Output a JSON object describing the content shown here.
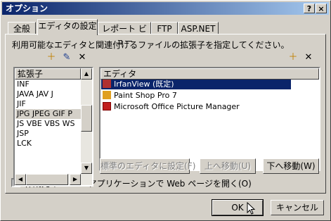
{
  "window": {
    "title": "オプション",
    "help_btn": "?",
    "close_btn": "×"
  },
  "tabs": [
    {
      "label": "全般"
    },
    {
      "label": "エディタの設定",
      "active": true
    },
    {
      "label": "レポート ビュー"
    },
    {
      "label": "FTP"
    },
    {
      "label": "ASP.NET"
    }
  ],
  "description": "利用可能なエディタと関連付けるファイルの拡張子を指定してください。",
  "extensions": {
    "header": "拡張子",
    "items": [
      "INF",
      "JAVA JAV J",
      "JIF",
      "JPG JPEG GIF P",
      "JS VBE VBS WS",
      "JSP",
      "LCK"
    ],
    "selected_index": 3
  },
  "editors": {
    "header": "エディタ",
    "items": [
      {
        "label": "IrfanView (既定)",
        "icon": "irfanview-icon",
        "selected": true
      },
      {
        "label": "Paint Shop Pro 7",
        "icon": "paintshop-icon"
      },
      {
        "label": "Microsoft Office Picture Manager",
        "icon": "picture-manager-icon"
      }
    ]
  },
  "buttons": {
    "set_default": "標準のエディタに設定(F)",
    "move_up": "上へ移動(U)",
    "move_down": "下へ移動(W)",
    "ok": "OK",
    "cancel": "キャンセル"
  },
  "checkbox": {
    "label": "作成元の Office アプリケーションで Web ページを開く(O)",
    "checked": true,
    "mark": "✓"
  },
  "icons": {
    "add": "＋",
    "edit": "✎",
    "remove": "✕",
    "scroll_up": "▲",
    "scroll_down": "▼"
  }
}
